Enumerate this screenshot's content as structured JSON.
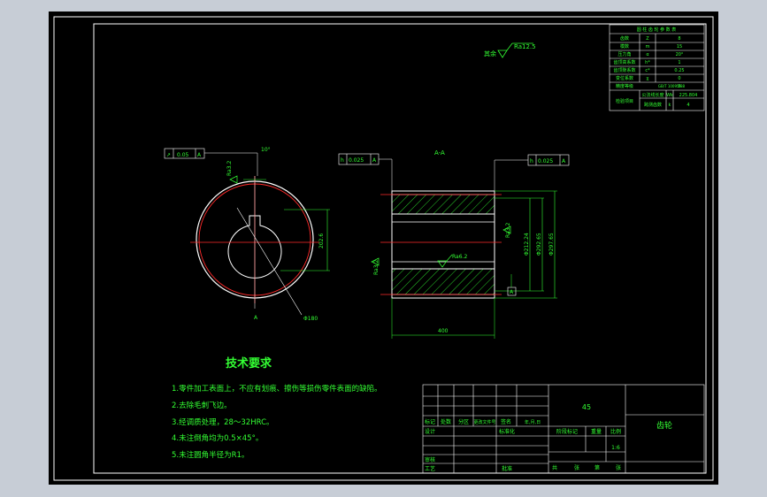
{
  "colors": {
    "background": "#000000",
    "frame": "#ffffff",
    "text": "#33ff33",
    "dimension": "#33ff33",
    "hatch": "#33ff33",
    "centerline": "#ff2a2a",
    "outer_gutter": "#c7cdd6"
  },
  "surface_note": {
    "left": "其余",
    "value": "Ra12.5"
  },
  "parameter_table": {
    "header": "圆 柱 齿 轮 参 数 表",
    "rows": [
      {
        "name": "齿数",
        "symbol": "Z",
        "value": "8"
      },
      {
        "name": "模数",
        "symbol": "m",
        "value": "15"
      },
      {
        "name": "压力角",
        "symbol": "α",
        "value": "20°"
      },
      {
        "name": "齿顶高系数",
        "symbol": "h*",
        "value": "1"
      },
      {
        "name": "齿顶隙系数",
        "symbol": "c*",
        "value": "0.25"
      },
      {
        "name": "变位系数",
        "symbol": "χ",
        "value": "0"
      },
      {
        "name": "精度等级",
        "symbol": "",
        "value": "8"
      }
    ],
    "standard": "GB/T 10095-88",
    "check_label": "检验项目",
    "check_rows": [
      {
        "name": "公法线长度",
        "symbol": "Wk",
        "value": "225.804"
      },
      {
        "name": "跨测齿数",
        "symbol": "k",
        "value": "4"
      }
    ]
  },
  "left_view": {
    "tolerance": {
      "symbol": "↗",
      "value": "0.05",
      "datum": "A"
    },
    "roughness_keyway": "Ra3.2",
    "keyway_angle": "10°",
    "dim_height": "202.6",
    "diameter": "Φ180",
    "section_label": "A"
  },
  "section_view": {
    "title": "A-A",
    "tolerance_left": {
      "symbol": "h",
      "value": "0.025",
      "datum": "A"
    },
    "tolerance_right": {
      "symbol": "h",
      "value": "0.025",
      "datum": "A"
    },
    "roughness_bore": "Ra6.2",
    "roughness_face": "Ra3.2",
    "roughness_gear": "Ra3.2",
    "dim_d1": "Φ212.24",
    "dim_d2": "Φ292.65",
    "dim_d3": "Φ297.65",
    "width": "400",
    "datum": "A"
  },
  "tech_requirements": {
    "title": "技术要求",
    "items": [
      "1.零件加工表面上，不应有划痕、擦伤等损伤零件表面的缺陷。",
      "2.去除毛刺飞边。",
      "3.经调质处理，28～32HRC。",
      "4.未注倒角均为0.5×45°。",
      "5.未注圆角半径为R1。"
    ]
  },
  "title_block": {
    "material": "45",
    "part_name": "齿轮",
    "headers": [
      "标记",
      "处数",
      "分区",
      "更改文件号",
      "签名",
      "年,月,日"
    ],
    "roles": [
      "设计",
      "审核",
      "工艺"
    ],
    "standardize": "标准化",
    "approve": "批准",
    "stage_mark": "阶段标记",
    "weight": "重量",
    "scale_label": "比例",
    "scale": "1:6",
    "sheet": [
      "共",
      "张",
      "第",
      "张"
    ]
  }
}
